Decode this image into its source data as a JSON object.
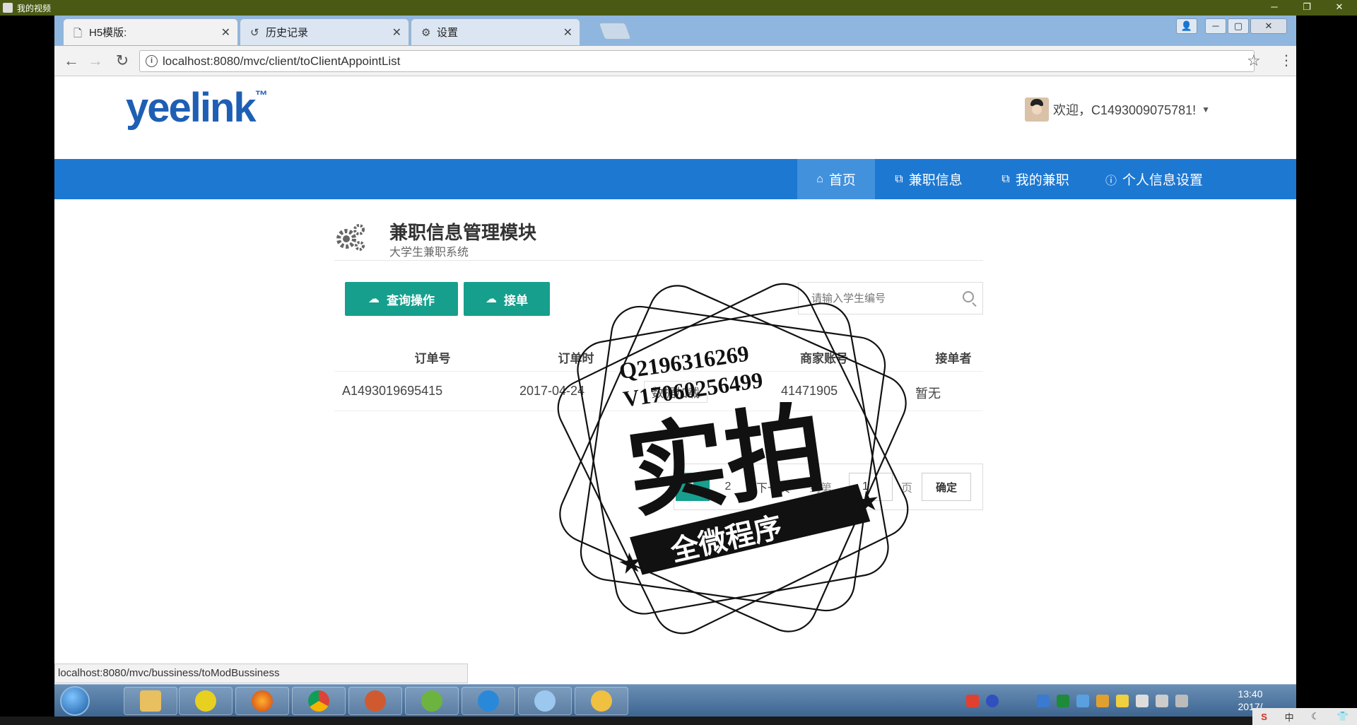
{
  "player": {
    "title": "我的视频"
  },
  "browser": {
    "tabs": [
      {
        "label": "H5模版:",
        "active": true
      },
      {
        "label": "历史记录",
        "active": false
      },
      {
        "label": "设置",
        "active": false
      }
    ],
    "url": "localhost:8080/mvc/client/toClientAppointList",
    "status_url": "localhost:8080/mvc/bussiness/toModBussiness"
  },
  "site": {
    "logo": "yeelink",
    "logo_tm": "™",
    "welcome": "欢迎，C1493009075781!",
    "nav": [
      {
        "label": "首页",
        "icon": "home-icon",
        "active": true
      },
      {
        "label": "兼职信息",
        "icon": "sitemap-icon",
        "active": false
      },
      {
        "label": "我的兼职",
        "icon": "sitemap-icon",
        "active": false
      },
      {
        "label": "个人信息设置",
        "icon": "info-circle-icon",
        "active": false
      }
    ]
  },
  "module": {
    "title": "兼职信息管理模块",
    "subtitle": "大学生兼职系统",
    "buttons": {
      "query": "查询操作",
      "accept": "接单"
    },
    "search_placeholder": "请输入学生编号"
  },
  "table": {
    "headers": [
      "订单号",
      "订单时",
      "商家账号",
      "接单者"
    ],
    "rows": [
      [
        "A1493019695415",
        "2017-04-24",
        "数据加载",
        "41471905",
        "暂无"
      ]
    ]
  },
  "pager": {
    "pages": [
      "1",
      "2"
    ],
    "next": "下一页",
    "goto_label": "到第",
    "goto_value": "1",
    "page_unit": "页",
    "confirm": "确定"
  },
  "watermark": {
    "line1": "Q2196316269",
    "line2": "V17060256499",
    "big": "实拍",
    "banner": "全微程序"
  },
  "taskbar": {
    "time": "13:40",
    "date": "2017/"
  },
  "ime": {
    "mode": "中"
  },
  "colors": {
    "nav_blue": "#1d78d2",
    "accent_green": "#179f8d",
    "logo_blue": "#1e5fb4"
  }
}
